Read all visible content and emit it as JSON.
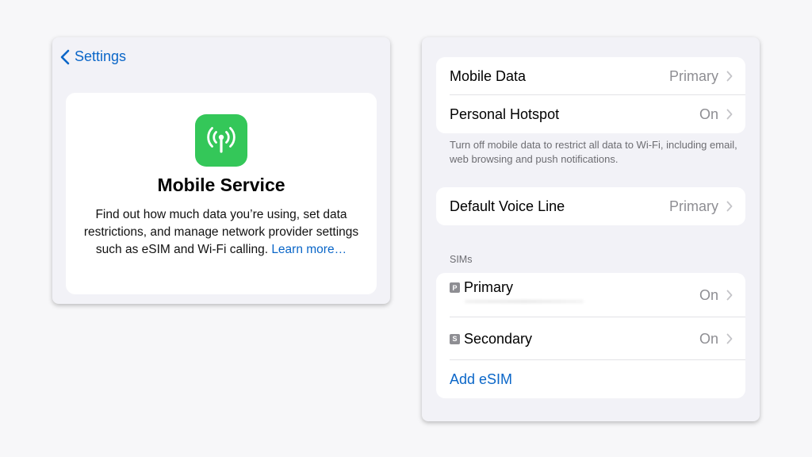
{
  "left_panel": {
    "back_label": "Settings",
    "hero": {
      "icon": "antenna-icon",
      "title": "Mobile Service",
      "description": "Find out how much data you’re using, set data restrictions, and manage network provider settings such as eSIM and Wi-Fi calling. ",
      "link": "Learn more…"
    }
  },
  "right_panel": {
    "group1": [
      {
        "label": "Mobile Data",
        "value": "Primary"
      },
      {
        "label": "Personal Hotspot",
        "value": "On"
      }
    ],
    "footnote": "Turn off mobile data to restrict all data to Wi-Fi, including email, web browsing and push notifications.",
    "group2": [
      {
        "label": "Default Voice Line",
        "value": "Primary"
      }
    ],
    "sims_header": "SIMs",
    "sims": [
      {
        "badge": "P",
        "label": "Primary",
        "value": "On"
      },
      {
        "badge": "S",
        "label": "Secondary",
        "value": "On"
      }
    ],
    "add_esim": "Add eSIM"
  },
  "colors": {
    "accent": "#0a66c8",
    "icon_green": "#34c759",
    "secondary_text": "#8e8e93"
  }
}
